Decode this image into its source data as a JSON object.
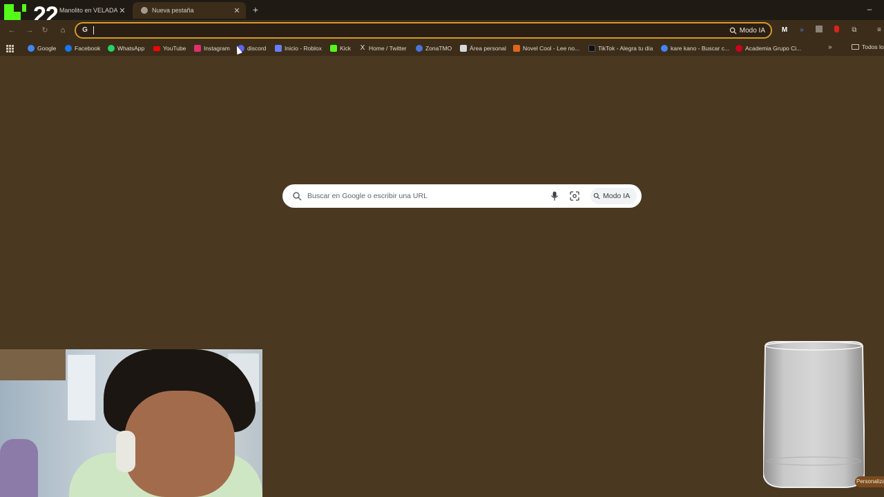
{
  "tabs": [
    {
      "title": "Manolito en VELADA A",
      "active": false
    },
    {
      "title": "Nueva pestaña",
      "active": true
    }
  ],
  "overlay": {
    "number": "22",
    "logo": "kick-logo"
  },
  "toolbar": {
    "omnibox_value": "",
    "modo_ia_label": "Modo IA"
  },
  "bookmarks": [
    {
      "label": "Google",
      "icon": "google-icon",
      "color": "#4285f4"
    },
    {
      "label": "Facebook",
      "icon": "facebook-icon",
      "color": "#1877f2"
    },
    {
      "label": "WhatsApp",
      "icon": "whatsapp-icon",
      "color": "#25d366"
    },
    {
      "label": "YouTube",
      "icon": "youtube-icon",
      "color": "#ff0000"
    },
    {
      "label": "Instagram",
      "icon": "instagram-icon",
      "color": "#e1306c"
    },
    {
      "label": "discord",
      "icon": "discord-icon",
      "color": "#5865f2"
    },
    {
      "label": "Inicio - Roblox",
      "icon": "roblox-icon",
      "color": "#6b7cff"
    },
    {
      "label": "Kick",
      "icon": "kick-icon",
      "color": "#53fc18"
    },
    {
      "label": "Home / Twitter",
      "icon": "x-icon",
      "color": "#e6e6e6"
    },
    {
      "label": "ZonaTMO",
      "icon": "zonatmo-icon",
      "color": "#4a74d9"
    },
    {
      "label": "Área personal",
      "icon": "area-personal-icon",
      "color": "#d8d8d8"
    },
    {
      "label": "Novel Cool - Lee no...",
      "icon": "novelcool-icon",
      "color": "#e0661c"
    },
    {
      "label": "TikTok - Alegra tu día",
      "icon": "tiktok-icon",
      "color": "#111111"
    },
    {
      "label": "kare kano - Buscar c...",
      "icon": "google-icon",
      "color": "#4285f4"
    },
    {
      "label": "Academia Grupo Ci...",
      "icon": "academia-icon",
      "color": "#d0021b"
    }
  ],
  "bookmarks_folder": "Todos los",
  "search": {
    "placeholder": "Buscar en Google o escribir una URL",
    "modo_ia_label": "Modo IA"
  },
  "personaliza": "Personaliza",
  "colors": {
    "page_bg": "#4a3820",
    "chrome_bg": "#3b2d1a",
    "omnibox_border": "#d49a2a",
    "kick_green": "#53fc18"
  }
}
